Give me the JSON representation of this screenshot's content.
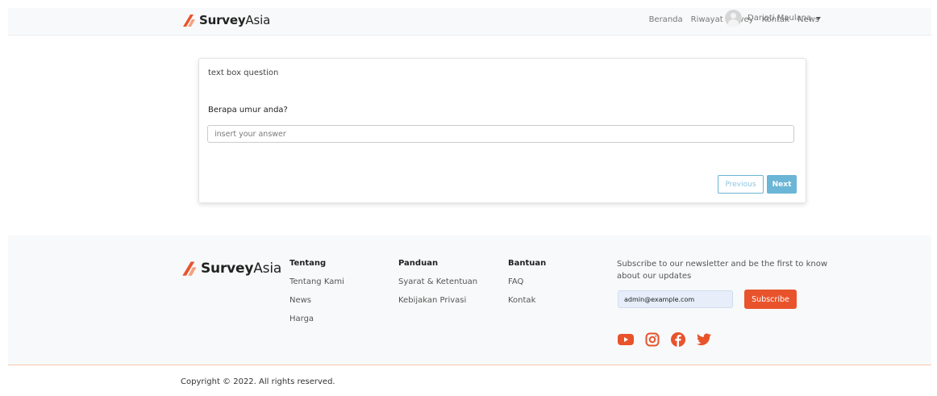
{
  "brand": {
    "bold": "Survey",
    "rest": "Asia",
    "color": "#e8532c"
  },
  "nav": {
    "items": [
      "Beranda",
      "Riwayat Survey",
      "Kontak",
      "News"
    ],
    "user_name": "Dariati Maulana"
  },
  "question": {
    "type_label": "text box question",
    "text": "Berapa umur anda?",
    "placeholder": "insert your answer",
    "value": "",
    "prev_label": "Previous",
    "next_label": "Next"
  },
  "footer": {
    "col1": {
      "title": "Tentang",
      "links": [
        "Tentang Kami",
        "News",
        "Harga"
      ]
    },
    "col2": {
      "title": "Panduan",
      "links": [
        "Syarat & Ketentuan",
        "Kebijakan Privasi"
      ]
    },
    "col3": {
      "title": "Bantuan",
      "links": [
        "FAQ",
        "Kontak"
      ]
    },
    "newsletter": {
      "text": "Subscribe to our newsletter and be the first to know about our updates",
      "email_value": "admin@example.com",
      "button": "Subscribe"
    },
    "social": [
      "youtube-icon",
      "instagram-icon",
      "facebook-icon",
      "twitter-icon"
    ],
    "copyright": "Copyright © 2022. All rights reserved."
  }
}
